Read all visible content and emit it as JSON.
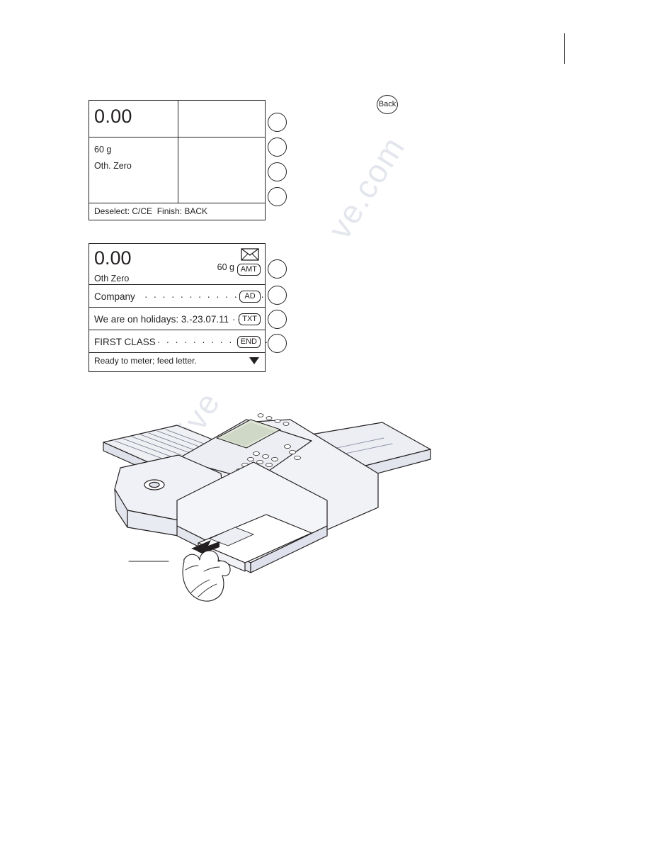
{
  "document": {
    "watermarks": [
      "ve.com",
      "shive"
    ]
  },
  "back_key": {
    "label": "Back",
    "name": "back-key"
  },
  "display1": {
    "amount": "0.00",
    "weight": "60 g",
    "zero_mode": "Oth. Zero",
    "status_line": "Deselect: C/CE  Finish: BACK",
    "softkeys": [
      "",
      "",
      "",
      ""
    ]
  },
  "display2": {
    "amount": "0.00",
    "weight": "60 g",
    "zero_mode": "Oth Zero",
    "envelope_icon": "envelope-icon",
    "rows": [
      {
        "label": "",
        "dots": "",
        "tag": "AMT"
      },
      {
        "label": "Company",
        "dots": "· · · · · · · · · · · · · · · · · · · · ·",
        "tag": "AD"
      },
      {
        "label": "We are on holidays: 3.-23.07.11",
        "dots": "··",
        "tag": "TXT"
      },
      {
        "label": "FIRST CLASS",
        "dots": "· · · · · · · · · · · · · · · ·",
        "tag": "END"
      }
    ],
    "status_line": "Ready to meter; feed letter.",
    "scroll_arrow": "triangle-down-icon",
    "softkeys": [
      "",
      "",
      "",
      ""
    ]
  },
  "illustration": {
    "name": "franking-machine-feeding-letter",
    "caption": ""
  }
}
